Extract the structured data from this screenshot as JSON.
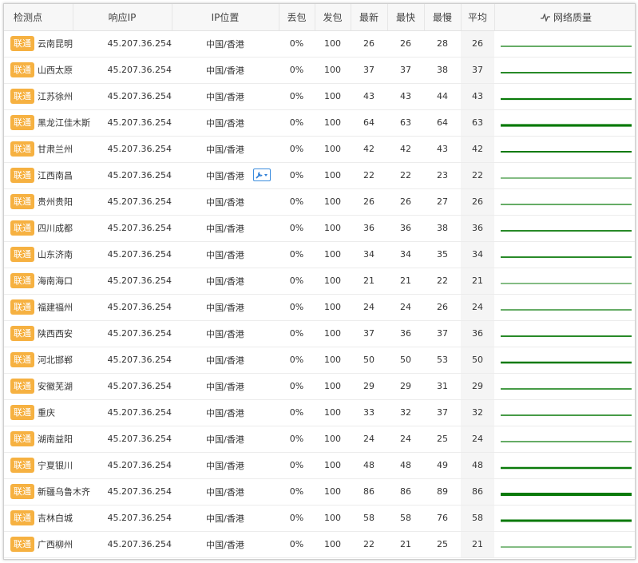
{
  "headers": {
    "node": "检测点",
    "ip": "响应IP",
    "location": "IP位置",
    "loss": "丢包",
    "sent": "发包",
    "latest": "最新",
    "fastest": "最快",
    "slowest": "最慢",
    "avg": "平均",
    "quality": "网络质量"
  },
  "colors": {
    "isp_badge": "#f6b141",
    "quality_line": "#0a7a0a",
    "tool_icon": "#2f7fd6"
  },
  "icons": {
    "quality_header": "activity-icon",
    "tool": "wrench-dropdown-icon"
  },
  "rows": [
    {
      "isp": "联通",
      "city": "云南昆明",
      "ip": "45.207.36.254",
      "loc": "中国/香港",
      "loss": "0%",
      "sent": "100",
      "latest": "26",
      "fastest": "26",
      "slowest": "28",
      "avg": "26"
    },
    {
      "isp": "联通",
      "city": "山西太原",
      "ip": "45.207.36.254",
      "loc": "中国/香港",
      "loss": "0%",
      "sent": "100",
      "latest": "37",
      "fastest": "37",
      "slowest": "38",
      "avg": "37"
    },
    {
      "isp": "联通",
      "city": "江苏徐州",
      "ip": "45.207.36.254",
      "loc": "中国/香港",
      "loss": "0%",
      "sent": "100",
      "latest": "43",
      "fastest": "43",
      "slowest": "44",
      "avg": "43"
    },
    {
      "isp": "联通",
      "city": "黑龙江佳木斯",
      "ip": "45.207.36.254",
      "loc": "中国/香港",
      "loss": "0%",
      "sent": "100",
      "latest": "64",
      "fastest": "63",
      "slowest": "64",
      "avg": "63"
    },
    {
      "isp": "联通",
      "city": "甘肃兰州",
      "ip": "45.207.36.254",
      "loc": "中国/香港",
      "loss": "0%",
      "sent": "100",
      "latest": "42",
      "fastest": "42",
      "slowest": "43",
      "avg": "42"
    },
    {
      "isp": "联通",
      "city": "江西南昌",
      "ip": "45.207.36.254",
      "loc": "中国/香港",
      "loss": "0%",
      "sent": "100",
      "latest": "22",
      "fastest": "22",
      "slowest": "23",
      "avg": "22"
    },
    {
      "isp": "联通",
      "city": "贵州贵阳",
      "ip": "45.207.36.254",
      "loc": "中国/香港",
      "loss": "0%",
      "sent": "100",
      "latest": "26",
      "fastest": "26",
      "slowest": "27",
      "avg": "26"
    },
    {
      "isp": "联通",
      "city": "四川成都",
      "ip": "45.207.36.254",
      "loc": "中国/香港",
      "loss": "0%",
      "sent": "100",
      "latest": "36",
      "fastest": "36",
      "slowest": "38",
      "avg": "36"
    },
    {
      "isp": "联通",
      "city": "山东济南",
      "ip": "45.207.36.254",
      "loc": "中国/香港",
      "loss": "0%",
      "sent": "100",
      "latest": "34",
      "fastest": "34",
      "slowest": "35",
      "avg": "34"
    },
    {
      "isp": "联通",
      "city": "海南海口",
      "ip": "45.207.36.254",
      "loc": "中国/香港",
      "loss": "0%",
      "sent": "100",
      "latest": "21",
      "fastest": "21",
      "slowest": "22",
      "avg": "21"
    },
    {
      "isp": "联通",
      "city": "福建福州",
      "ip": "45.207.36.254",
      "loc": "中国/香港",
      "loss": "0%",
      "sent": "100",
      "latest": "24",
      "fastest": "24",
      "slowest": "26",
      "avg": "24"
    },
    {
      "isp": "联通",
      "city": "陕西西安",
      "ip": "45.207.36.254",
      "loc": "中国/香港",
      "loss": "0%",
      "sent": "100",
      "latest": "37",
      "fastest": "36",
      "slowest": "37",
      "avg": "36"
    },
    {
      "isp": "联通",
      "city": "河北邯郸",
      "ip": "45.207.36.254",
      "loc": "中国/香港",
      "loss": "0%",
      "sent": "100",
      "latest": "50",
      "fastest": "50",
      "slowest": "53",
      "avg": "50"
    },
    {
      "isp": "联通",
      "city": "安徽芜湖",
      "ip": "45.207.36.254",
      "loc": "中国/香港",
      "loss": "0%",
      "sent": "100",
      "latest": "29",
      "fastest": "29",
      "slowest": "31",
      "avg": "29"
    },
    {
      "isp": "联通",
      "city": "重庆",
      "ip": "45.207.36.254",
      "loc": "中国/香港",
      "loss": "0%",
      "sent": "100",
      "latest": "33",
      "fastest": "32",
      "slowest": "37",
      "avg": "32"
    },
    {
      "isp": "联通",
      "city": "湖南益阳",
      "ip": "45.207.36.254",
      "loc": "中国/香港",
      "loss": "0%",
      "sent": "100",
      "latest": "24",
      "fastest": "24",
      "slowest": "25",
      "avg": "24"
    },
    {
      "isp": "联通",
      "city": "宁夏银川",
      "ip": "45.207.36.254",
      "loc": "中国/香港",
      "loss": "0%",
      "sent": "100",
      "latest": "48",
      "fastest": "48",
      "slowest": "49",
      "avg": "48"
    },
    {
      "isp": "联通",
      "city": "新疆乌鲁木齐",
      "ip": "45.207.36.254",
      "loc": "中国/香港",
      "loss": "0%",
      "sent": "100",
      "latest": "86",
      "fastest": "86",
      "slowest": "89",
      "avg": "86"
    },
    {
      "isp": "联通",
      "city": "吉林白城",
      "ip": "45.207.36.254",
      "loc": "中国/香港",
      "loss": "0%",
      "sent": "100",
      "latest": "58",
      "fastest": "58",
      "slowest": "76",
      "avg": "58"
    },
    {
      "isp": "联通",
      "city": "广西柳州",
      "ip": "45.207.36.254",
      "loc": "中国/香港",
      "loss": "0%",
      "sent": "100",
      "latest": "22",
      "fastest": "21",
      "slowest": "25",
      "avg": "21"
    }
  ]
}
